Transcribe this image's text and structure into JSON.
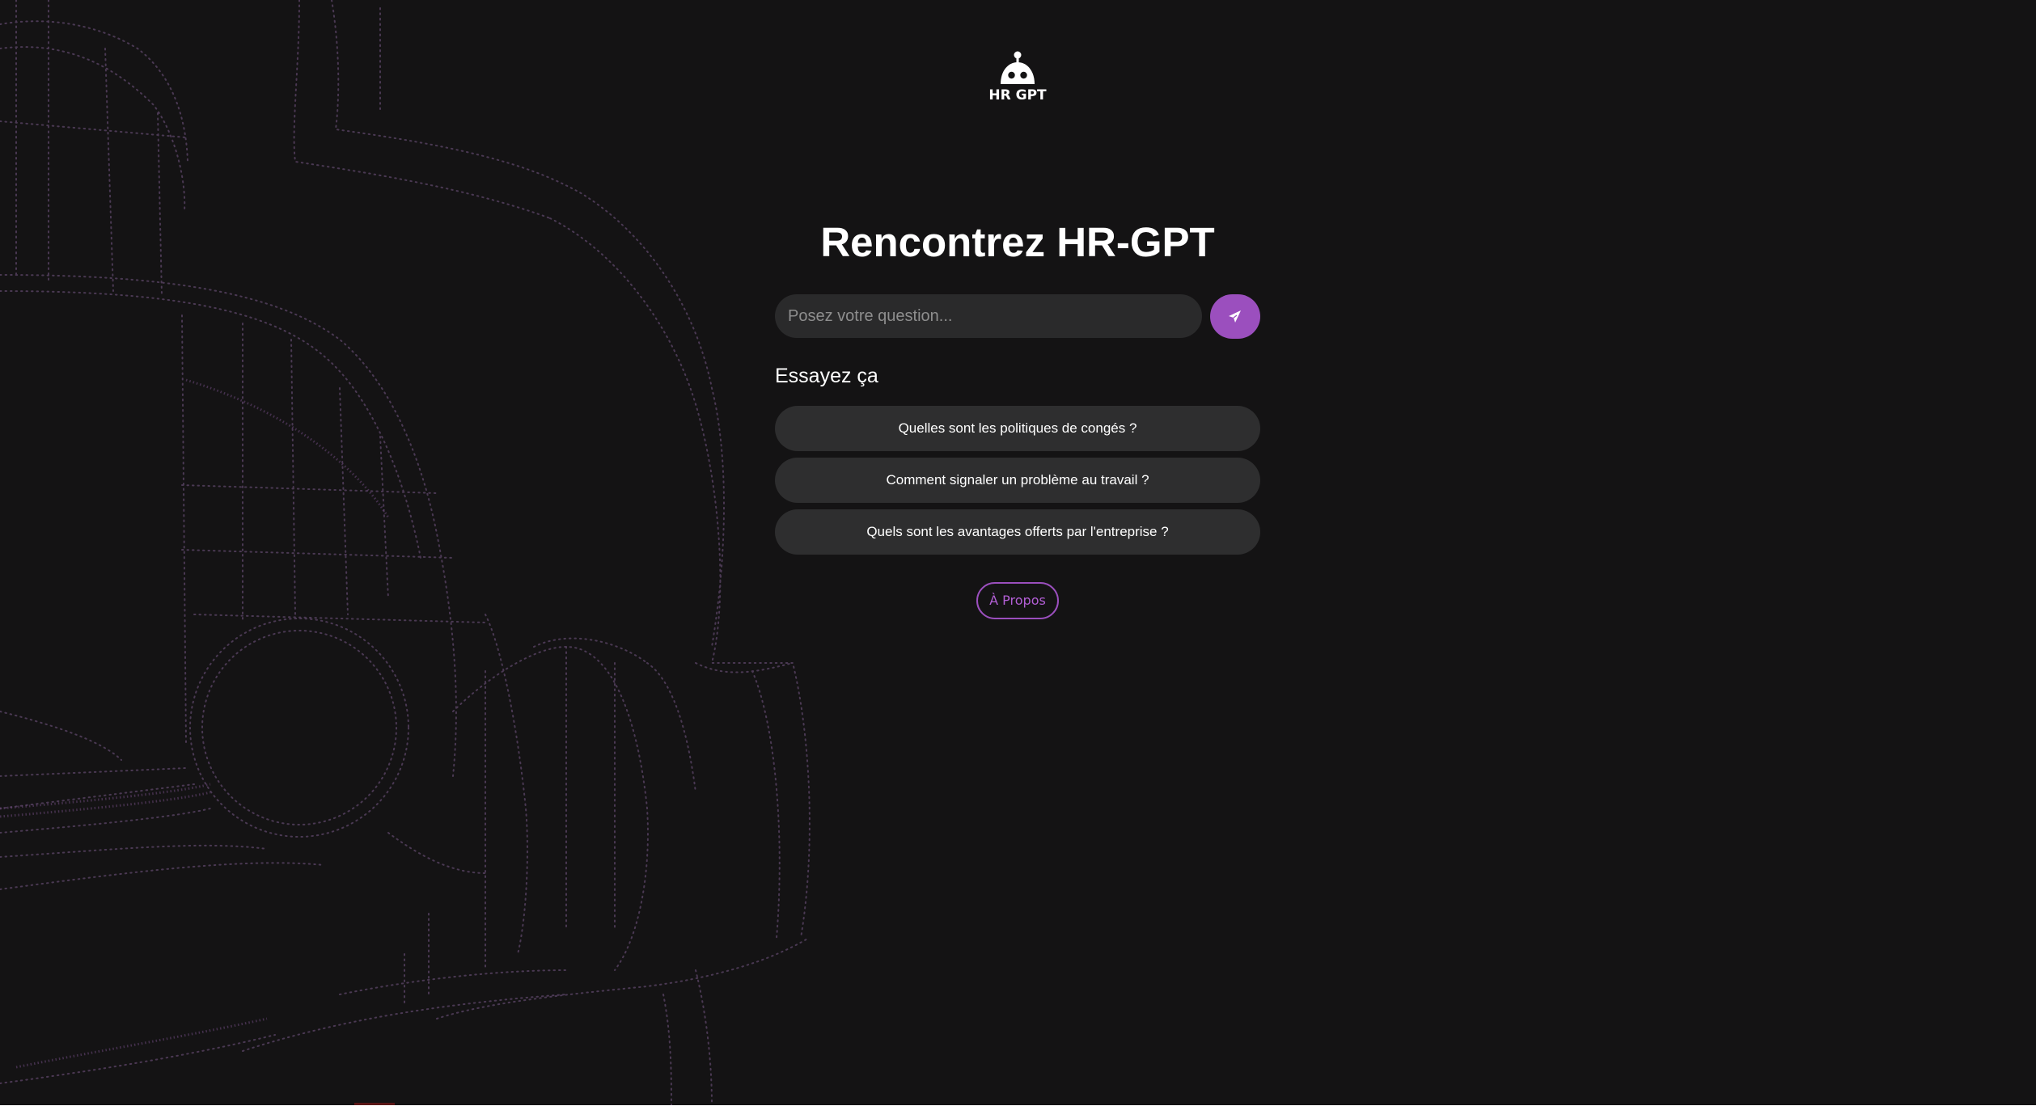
{
  "app": {
    "logo_text": "HR GPT",
    "accent_color": "#9b4fbe",
    "background_color": "#141314"
  },
  "hero": {
    "title": "Rencontrez HR-GPT"
  },
  "search": {
    "placeholder": "Posez votre question...",
    "value": "",
    "send_icon": "paper-plane-icon"
  },
  "suggestions": {
    "title": "Essayez ça",
    "items": [
      {
        "label": "Quelles sont les politiques de congés ?"
      },
      {
        "label": "Comment signaler un problème au travail ?"
      },
      {
        "label": "Quels sont les avantages offerts par l'entreprise ?"
      }
    ]
  },
  "footer": {
    "about_label": "À Propos"
  }
}
